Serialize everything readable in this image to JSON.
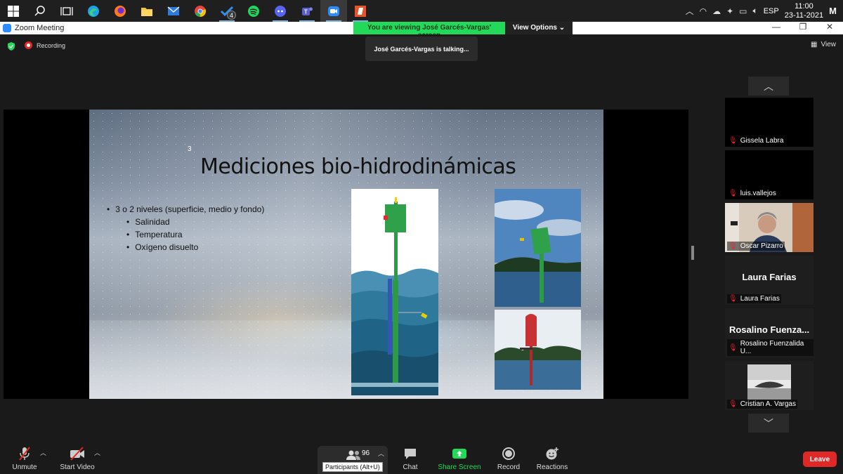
{
  "taskbar": {
    "apps": [
      {
        "name": "windows-start-icon"
      },
      {
        "name": "search-icon"
      },
      {
        "name": "task-view-icon"
      },
      {
        "name": "edge-icon"
      },
      {
        "name": "firefox-icon"
      },
      {
        "name": "file-explorer-icon"
      },
      {
        "name": "mail-icon"
      },
      {
        "name": "chrome-icon"
      },
      {
        "name": "todo-icon",
        "badge": "4"
      },
      {
        "name": "spotify-icon"
      },
      {
        "name": "discord-icon"
      },
      {
        "name": "teams-icon"
      },
      {
        "name": "zoom-icon"
      },
      {
        "name": "powerpoint-icon"
      }
    ],
    "language": "ESP",
    "time": "11:00",
    "date": "23-11-2021"
  },
  "window": {
    "title": "Zoom Meeting",
    "viewing_banner": "You are viewing José Garcés-Vargas' screen",
    "view_options": "View Options"
  },
  "meeting": {
    "recording_label": "Recording",
    "talking": "José Garcés-Vargas is talking...",
    "view_label": "View"
  },
  "slide": {
    "number": "3",
    "title": "Mediciones bio-hidrodinámicas",
    "bullet_main": "3 o 2 niveles (superficie, medio y fondo)",
    "sub_bullets": [
      "Salinidad",
      "Temperatura",
      "Oxígeno disuelto"
    ]
  },
  "participants": [
    {
      "name": "Gissela Labra",
      "muted": true,
      "display": ""
    },
    {
      "name": "luis.vallejos",
      "muted": true,
      "display": ""
    },
    {
      "name": "Oscar Pizarro",
      "muted": true,
      "display": "video"
    },
    {
      "name": "Laura Farias",
      "muted": true,
      "display": "Laura Farias"
    },
    {
      "name": "Rosalino Fuenzalida U...",
      "muted": true,
      "display": "Rosalino  Fuenza..."
    },
    {
      "name": "Cristian A. Vargas",
      "muted": true,
      "display": "photo"
    }
  ],
  "toolbar": {
    "unmute": "Unmute",
    "start_video": "Start Video",
    "participants_count": "96",
    "participants_tooltip": "Participants (Alt+U)",
    "chat": "Chat",
    "share_screen": "Share Screen",
    "record": "Record",
    "reactions": "Reactions",
    "leave": "Leave"
  },
  "colors": {
    "share_green": "#23d959",
    "leave_red": "#e02828",
    "mute_red": "#e02828"
  }
}
